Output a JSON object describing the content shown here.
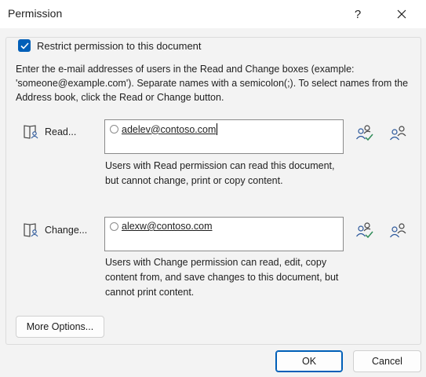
{
  "window": {
    "title": "Permission",
    "help_label": "?"
  },
  "restrict": {
    "label": "Restrict permission to this document",
    "checked": true
  },
  "intro_text": "Enter the e-mail addresses of users in the Read and Change boxes (example: 'someone@example.com'). Separate names with a semicolon(;). To select names from the Address book, click the Read or Change button.",
  "read": {
    "button_label": "Read...",
    "email": "adelev@contoso.com",
    "description": "Users with Read permission can read this document, but cannot change, print or copy content."
  },
  "change": {
    "button_label": "Change...",
    "email": "alexw@contoso.com",
    "description": "Users with Change permission can read, edit, copy content from, and save changes to this document, but cannot print content."
  },
  "buttons": {
    "more_options": "More Options...",
    "ok": "OK",
    "cancel": "Cancel"
  },
  "colors": {
    "accent": "#005fb8",
    "check_green": "#2e8b57",
    "icon_blue": "#2b579a"
  },
  "icons": [
    "address-book-icon",
    "check-names-icon",
    "user-directory-icon",
    "close-icon"
  ]
}
